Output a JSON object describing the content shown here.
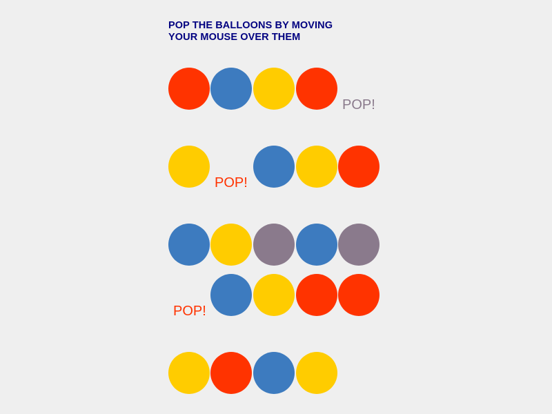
{
  "title_line1": "POP THE BALLOONS BY MOVING",
  "title_line2": "YOUR MOUSE OVER THEM",
  "colors": {
    "red": "#ff3300",
    "blue": "#3d7bbf",
    "yellow": "#ffcc00",
    "purple": "#8a7a8c",
    "title": "#000080"
  },
  "rows": [
    [
      "red",
      "blue",
      "yellow",
      "red",
      {
        "pop": "POP!",
        "color": "#8a7a8c"
      }
    ],
    [
      "yellow",
      {
        "pop": "POP!",
        "color": "#ff3300"
      },
      "blue",
      "yellow",
      "red"
    ],
    [
      "blue",
      "yellow",
      "purple",
      "blue",
      "purple"
    ],
    [
      {
        "pop": "POP!",
        "color": "#ff3300"
      },
      "blue",
      "yellow",
      "red",
      "red"
    ],
    [
      "yellow",
      "red",
      "blue",
      "yellow",
      null
    ]
  ]
}
